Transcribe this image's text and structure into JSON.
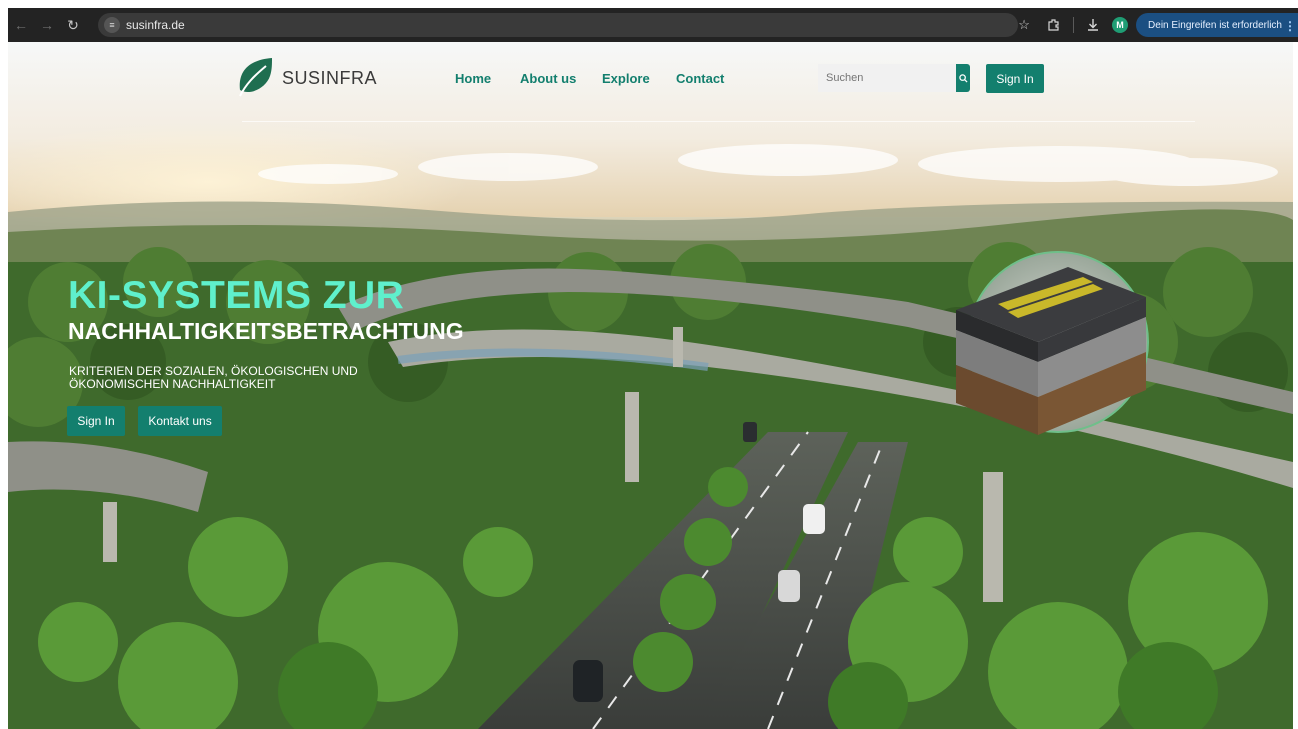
{
  "browser": {
    "url": "susinfra.de",
    "profile_initial": "M",
    "attention_label": "Dein Eingreifen ist erforderlich"
  },
  "header": {
    "brand": "SUSINFRA",
    "nav": [
      "Home",
      "About us",
      "Explore",
      "Contact"
    ],
    "search_placeholder": "Suchen",
    "signin_label": "Sign In"
  },
  "hero": {
    "title": "KI-SYSTEMS ZUR",
    "subtitle": "NACHHALTIGKEITSBETRACHTUNG",
    "description": "KRITERIEN DER SOZIALEN, ÖKOLOGISCHEN UND ÖKONOMISCHEN NACHHALTIGKEIT",
    "buttons": [
      "Sign In",
      "Kontakt uns"
    ]
  },
  "colors": {
    "brand_teal": "#137f6e",
    "title_mint": "#5ff0cc"
  },
  "icons": [
    "back-icon",
    "forward-icon",
    "reload-icon",
    "site-info-icon",
    "star-icon",
    "extension-icon",
    "download-icon",
    "menu-dots-icon",
    "search-icon",
    "leaf-logo-icon"
  ]
}
